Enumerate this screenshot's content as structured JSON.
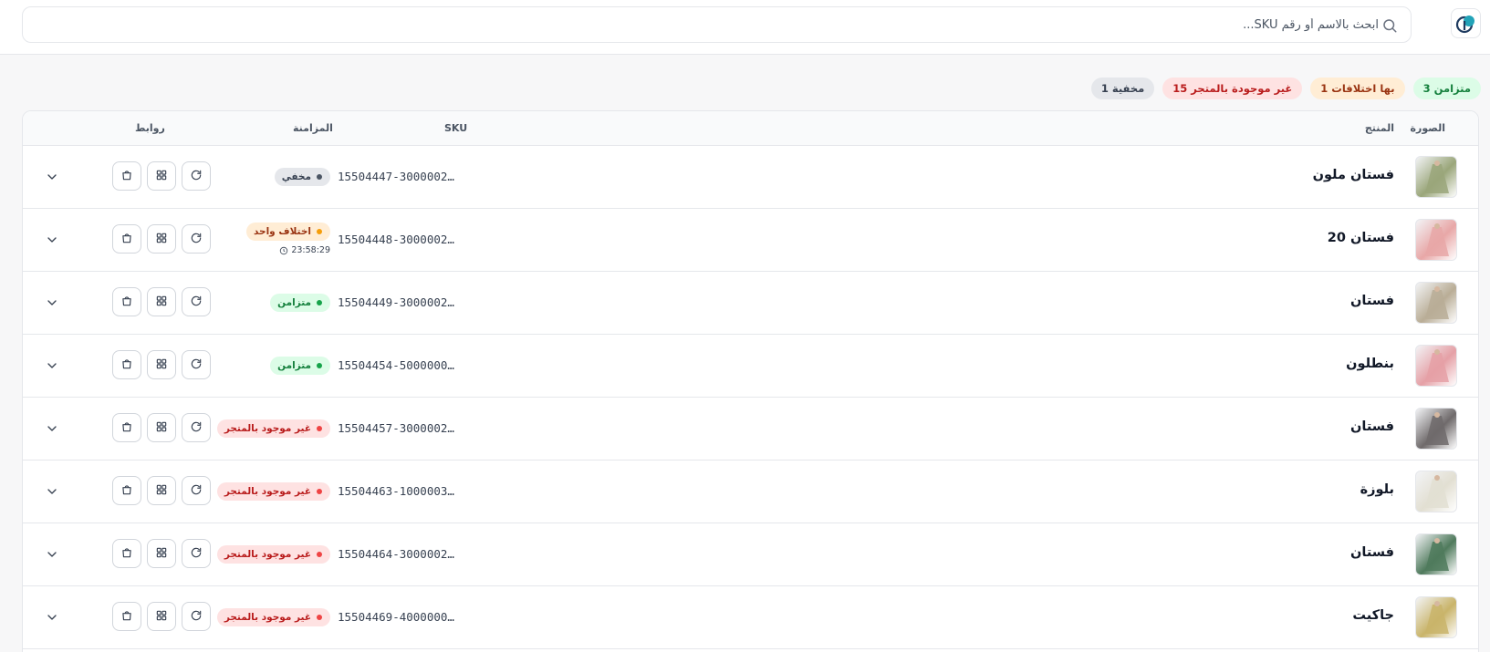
{
  "search": {
    "placeholder": "ابحث بالاسم أو رقم SKU..."
  },
  "summary": {
    "synced": "3 متزامن",
    "diffs": "1 بها اختلافات",
    "missing": "15 غير موجودة بالمتجر",
    "hidden": "1 مخفية"
  },
  "table": {
    "headers": {
      "image": "الصورة",
      "product": "المنتج",
      "sku": "SKU",
      "sync": "المزامنة",
      "links": "روابط"
    },
    "rows": [
      {
        "name": "فستان ملون",
        "sku": "15504447-3000002…",
        "status": "مخفي",
        "status_kind": "gray",
        "thumb_color": "#9aa67a"
      },
      {
        "name": "فستان 20",
        "sku": "15504448-3000002…",
        "status": "اختلاف واحد",
        "status_kind": "orange",
        "time": "23:58:29",
        "thumb_color": "#e8a7a7"
      },
      {
        "name": "فستان",
        "sku": "15504449-3000002…",
        "status": "متزامن",
        "status_kind": "green",
        "thumb_color": "#b9ad96"
      },
      {
        "name": "بنطلون",
        "sku": "15504454-5000000…",
        "status": "متزامن",
        "status_kind": "green",
        "thumb_color": "#e5a0a6"
      },
      {
        "name": "فستان",
        "sku": "15504457-3000002…",
        "status": "غير موجود بالمتجر",
        "status_kind": "red",
        "thumb_color": "#6f6a6b"
      },
      {
        "name": "بلوزة",
        "sku": "15504463-1000003…",
        "status": "غير موجود بالمتجر",
        "status_kind": "red",
        "thumb_color": "#e2dfd2"
      },
      {
        "name": "فستان",
        "sku": "15504464-3000002…",
        "status": "غير موجود بالمتجر",
        "status_kind": "red",
        "thumb_color": "#4f7a5c"
      },
      {
        "name": "جاكيت",
        "sku": "15504469-4000000…",
        "status": "غير موجود بالمتجر",
        "status_kind": "red",
        "thumb_color": "#c9b46a"
      }
    ]
  }
}
